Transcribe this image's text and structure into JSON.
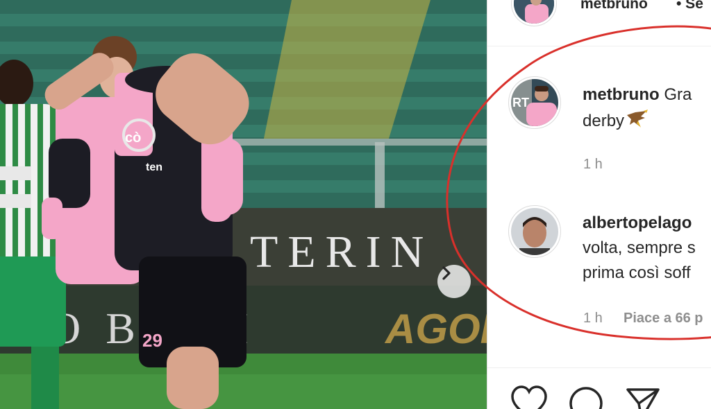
{
  "post": {
    "author": "metbruno",
    "header_suffix": "• Se"
  },
  "comments": [
    {
      "username": "metbruno",
      "text_line1": "Gra",
      "text_line2": "derby",
      "time": "1 h"
    },
    {
      "username": "albertopelago",
      "text_line1": "volta, sempre s",
      "text_line2": "prima così soff",
      "time": "1 h",
      "likes": "Piace a 66 p"
    }
  ],
  "photo": {
    "ad_board_text": "TERIN",
    "ad_board_text2": "O  B  NTI",
    "sponsor_text": "AGOR"
  },
  "icons": {
    "next": "chevron-right-icon",
    "like": "heart-icon",
    "comment": "speech-bubble-icon",
    "share": "paper-plane-icon",
    "emoji": "eagle-emoji"
  },
  "colors": {
    "annotation_circle": "#d9302b",
    "palermo_pink": "#f2a7c9",
    "text_dark": "#262626",
    "text_grey": "#8e8e8e"
  }
}
